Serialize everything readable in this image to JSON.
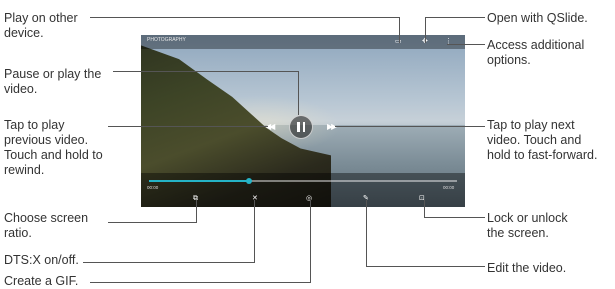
{
  "screen": {
    "video_title": "PHOTOGRAPHY",
    "time_elapsed": "00:00",
    "time_total": "00:00",
    "progress_fraction": 0.325,
    "icons": {
      "play_other_device": "cast-icon",
      "qslide": "qslide-icon",
      "more_options": "more-vertical-icon",
      "pause": "pause-icon",
      "previous": "rewind-icon",
      "next": "fast-forward-icon",
      "ratio": "screen-ratio-icon",
      "dts": "dts-x-icon",
      "gif": "gif-icon",
      "edit": "pencil-icon",
      "lock": "lock-icon"
    },
    "accent_color": "#25b3c6"
  },
  "labels": {
    "play_other_device": "Play on other\ndevice.",
    "pause_play": "Pause or play the\nvideo.",
    "prev_video": "Tap to play\nprevious video.\nTouch and hold to\nrewind.",
    "screen_ratio": "Choose screen\nratio.",
    "dts": "DTS:X on/off.",
    "gif": "Create a GIF.",
    "qslide": "Open with QSlide.",
    "additional": "Access additional\noptions.",
    "next_video": "Tap to play next\nvideo. Touch and\nhold to fast-forward.",
    "lock": "Lock or unlock\nthe screen.",
    "edit": "Edit the video."
  }
}
